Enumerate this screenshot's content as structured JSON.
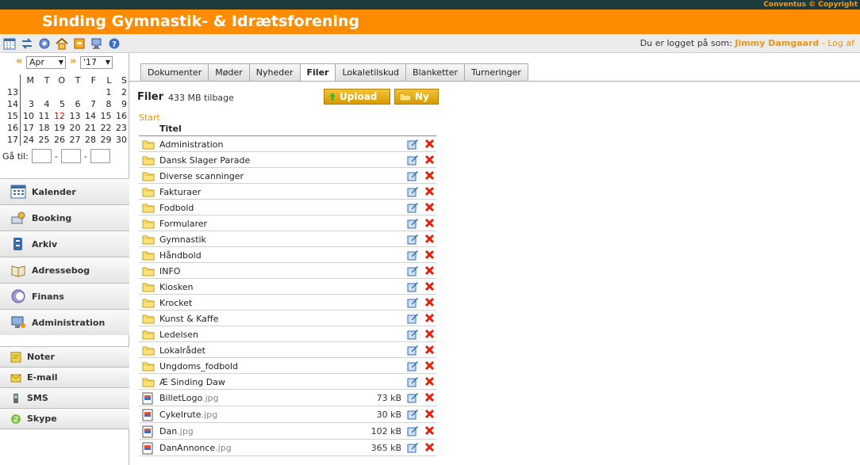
{
  "header": {
    "title": "Sinding Gymnastik- & Idrætsforening",
    "copyright": "Conventus © Copyright"
  },
  "userbar": {
    "label": "Du er logget på som:",
    "username": "Jimmy Damgaard",
    "separator": "-",
    "logout": "Log af"
  },
  "toolbar_icons": [
    "calendar-icon",
    "swap-icon",
    "settings-icon",
    "home-icon",
    "archive-box-icon",
    "computer-icon",
    "help-icon"
  ],
  "calendar": {
    "prev": "«",
    "next": "»",
    "month": "Apr",
    "year": "'17",
    "weekdays": [
      "M",
      "T",
      "O",
      "T",
      "F",
      "L",
      "S"
    ],
    "weeks": [
      {
        "wk": "13",
        "days": [
          "",
          "",
          "",
          "",
          "",
          "1",
          "2"
        ]
      },
      {
        "wk": "14",
        "days": [
          "3",
          "4",
          "5",
          "6",
          "7",
          "8",
          "9"
        ]
      },
      {
        "wk": "15",
        "days": [
          "10",
          "11",
          "12",
          "13",
          "14",
          "15",
          "16"
        ]
      },
      {
        "wk": "16",
        "days": [
          "17",
          "18",
          "19",
          "20",
          "21",
          "22",
          "23"
        ]
      },
      {
        "wk": "17",
        "days": [
          "24",
          "25",
          "26",
          "27",
          "28",
          "29",
          "30"
        ]
      }
    ],
    "today": "12",
    "goto_label": "Gå til:",
    "goto_sep": "-"
  },
  "menu": [
    {
      "label": "Kalender",
      "icon": "calendar-icon"
    },
    {
      "label": "Booking",
      "icon": "booking-icon"
    },
    {
      "label": "Arkiv",
      "icon": "archive-icon"
    },
    {
      "label": "Adressebog",
      "icon": "address-book-icon"
    },
    {
      "label": "Finans",
      "icon": "finance-icon"
    },
    {
      "label": "Administration",
      "icon": "administration-icon"
    }
  ],
  "menu2": [
    {
      "label": "Noter",
      "icon": "notes-icon"
    },
    {
      "label": "E-mail",
      "icon": "email-icon"
    },
    {
      "label": "SMS",
      "icon": "sms-icon"
    },
    {
      "label": "Skype",
      "icon": "skype-icon"
    }
  ],
  "tabs": [
    "Dokumenter",
    "Møder",
    "Nyheder",
    "Filer",
    "Lokaletilskud",
    "Blanketter",
    "Turneringer"
  ],
  "active_tab": "Filer",
  "files": {
    "title": "Filer",
    "space": "433 MB tilbage",
    "upload_label": "Upload",
    "new_label": "Ny",
    "breadcrumb": "Start",
    "column_title": "Titel",
    "folders": [
      "Administration",
      "Dansk Slager Parade",
      "Diverse scanninger",
      "Fakturaer",
      "Fodbold",
      "Formularer",
      "Gymnastik",
      "Håndbold",
      "INFO",
      "Kiosken",
      "Krocket",
      "Kunst & Kaffe",
      "Ledelsen",
      "Lokalrådet",
      "Ungdoms_fodbold",
      "Æ Sinding Daw"
    ],
    "items": [
      {
        "base": "BilletLogo",
        "ext": ".jpg",
        "size": "73 kB"
      },
      {
        "base": "Cykelrute",
        "ext": ".jpg",
        "size": "30 kB"
      },
      {
        "base": "Dan",
        "ext": ".jpg",
        "size": "102 kB"
      },
      {
        "base": "DanAnnonce",
        "ext": ".jpg",
        "size": "365 kB"
      }
    ]
  },
  "colors": {
    "header_bg": "#ff8c00",
    "accent": "#e8961a",
    "topstrip": "#1d3b3b",
    "button": "#e5ad12"
  }
}
